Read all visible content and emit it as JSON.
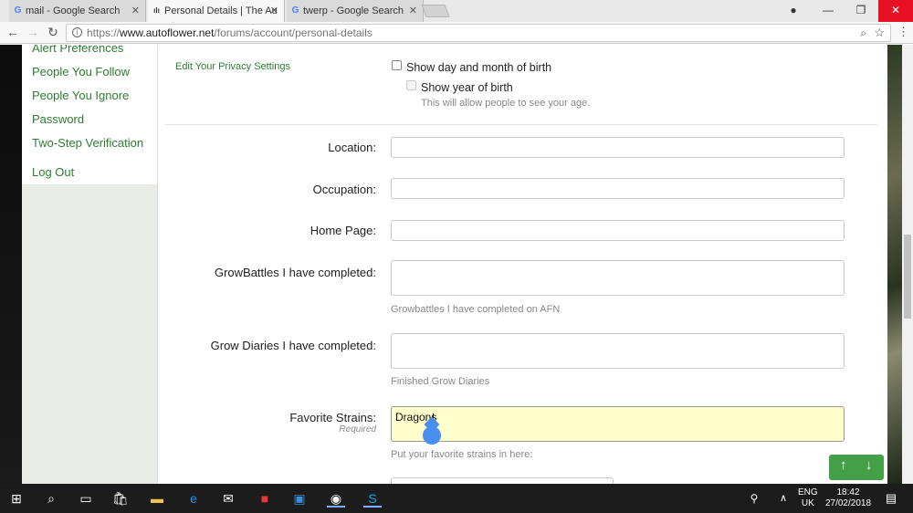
{
  "browser": {
    "tabs": [
      {
        "title": "mail - Google Search",
        "favicon": "G"
      },
      {
        "title": "Personal Details | The Au",
        "favicon": "ılı"
      },
      {
        "title": "twerp - Google Search",
        "favicon": "G"
      }
    ],
    "url_prefix": "https://",
    "url_domain": "www.autoflower.net",
    "url_path": "/forums/account/personal-details"
  },
  "sidebar": {
    "items": [
      "Alert Preferences",
      "People You Follow",
      "People You Ignore",
      "Password",
      "Two-Step Verification",
      "Log Out"
    ]
  },
  "privacy": {
    "link": "Edit Your Privacy Settings",
    "show_day_month": "Show day and month of birth",
    "show_year": "Show year of birth",
    "age_hint": "This will allow people to see your age."
  },
  "form": {
    "location_label": "Location:",
    "occupation_label": "Occupation:",
    "homepage_label": "Home Page:",
    "growbattles_label": "GrowBattles I have completed:",
    "growbattles_hint": "Growbattles I have completed on AFN",
    "growdiaries_label": "Grow Diaries I have completed:",
    "growdiaries_hint": "Finished Grow Diaries",
    "strains_label": "Favorite Strains:",
    "strains_required": "Required",
    "strains_value": "Dragons",
    "strains_hint": "Put your favorite strains in here:"
  },
  "taskbar": {
    "lang_top": "ENG",
    "lang_bottom": "UK",
    "time": "18:42",
    "date": "27/02/2018"
  },
  "colors": {
    "accent_green": "#2e7d32",
    "highlight_field": "#ffffcc",
    "close_red": "#e81123"
  }
}
